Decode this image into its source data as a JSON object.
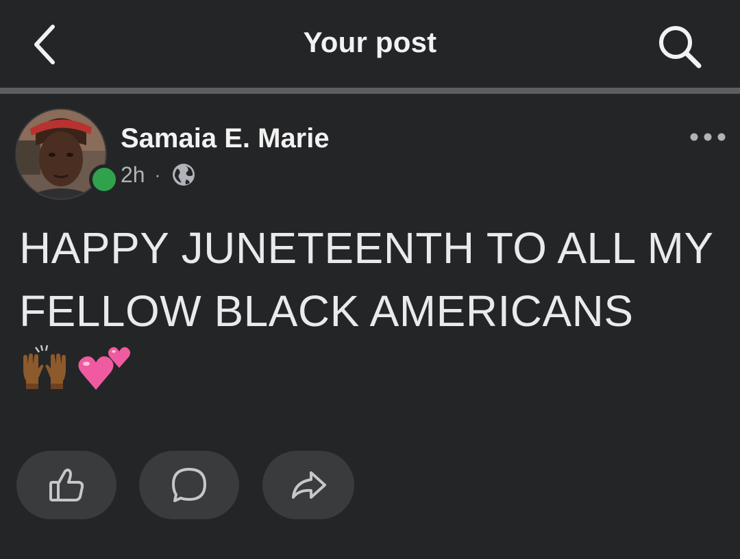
{
  "header": {
    "title": "Your post",
    "back_icon": "chevron-left-icon",
    "search_icon": "search-icon"
  },
  "post": {
    "author": "Samaia E. Marie",
    "time": "2h",
    "separator": "·",
    "privacy_icon": "globe-icon",
    "online": true,
    "text_line1": "HAPPY JUNETEENTH TO ALL MY",
    "text_line2": "FELLOW BLACK AMERICANS",
    "emojis": [
      "raising-hands-emoji",
      "two-hearts-emoji"
    ]
  },
  "actions": {
    "like_icon": "thumbs-up-icon",
    "comment_icon": "comment-bubble-icon",
    "share_icon": "share-arrow-icon"
  },
  "colors": {
    "background": "#242527",
    "divider": "#5d5e62",
    "button_bg": "#3a3b3d",
    "online_green": "#31a24c",
    "secondary_text": "#b0b3b8"
  }
}
